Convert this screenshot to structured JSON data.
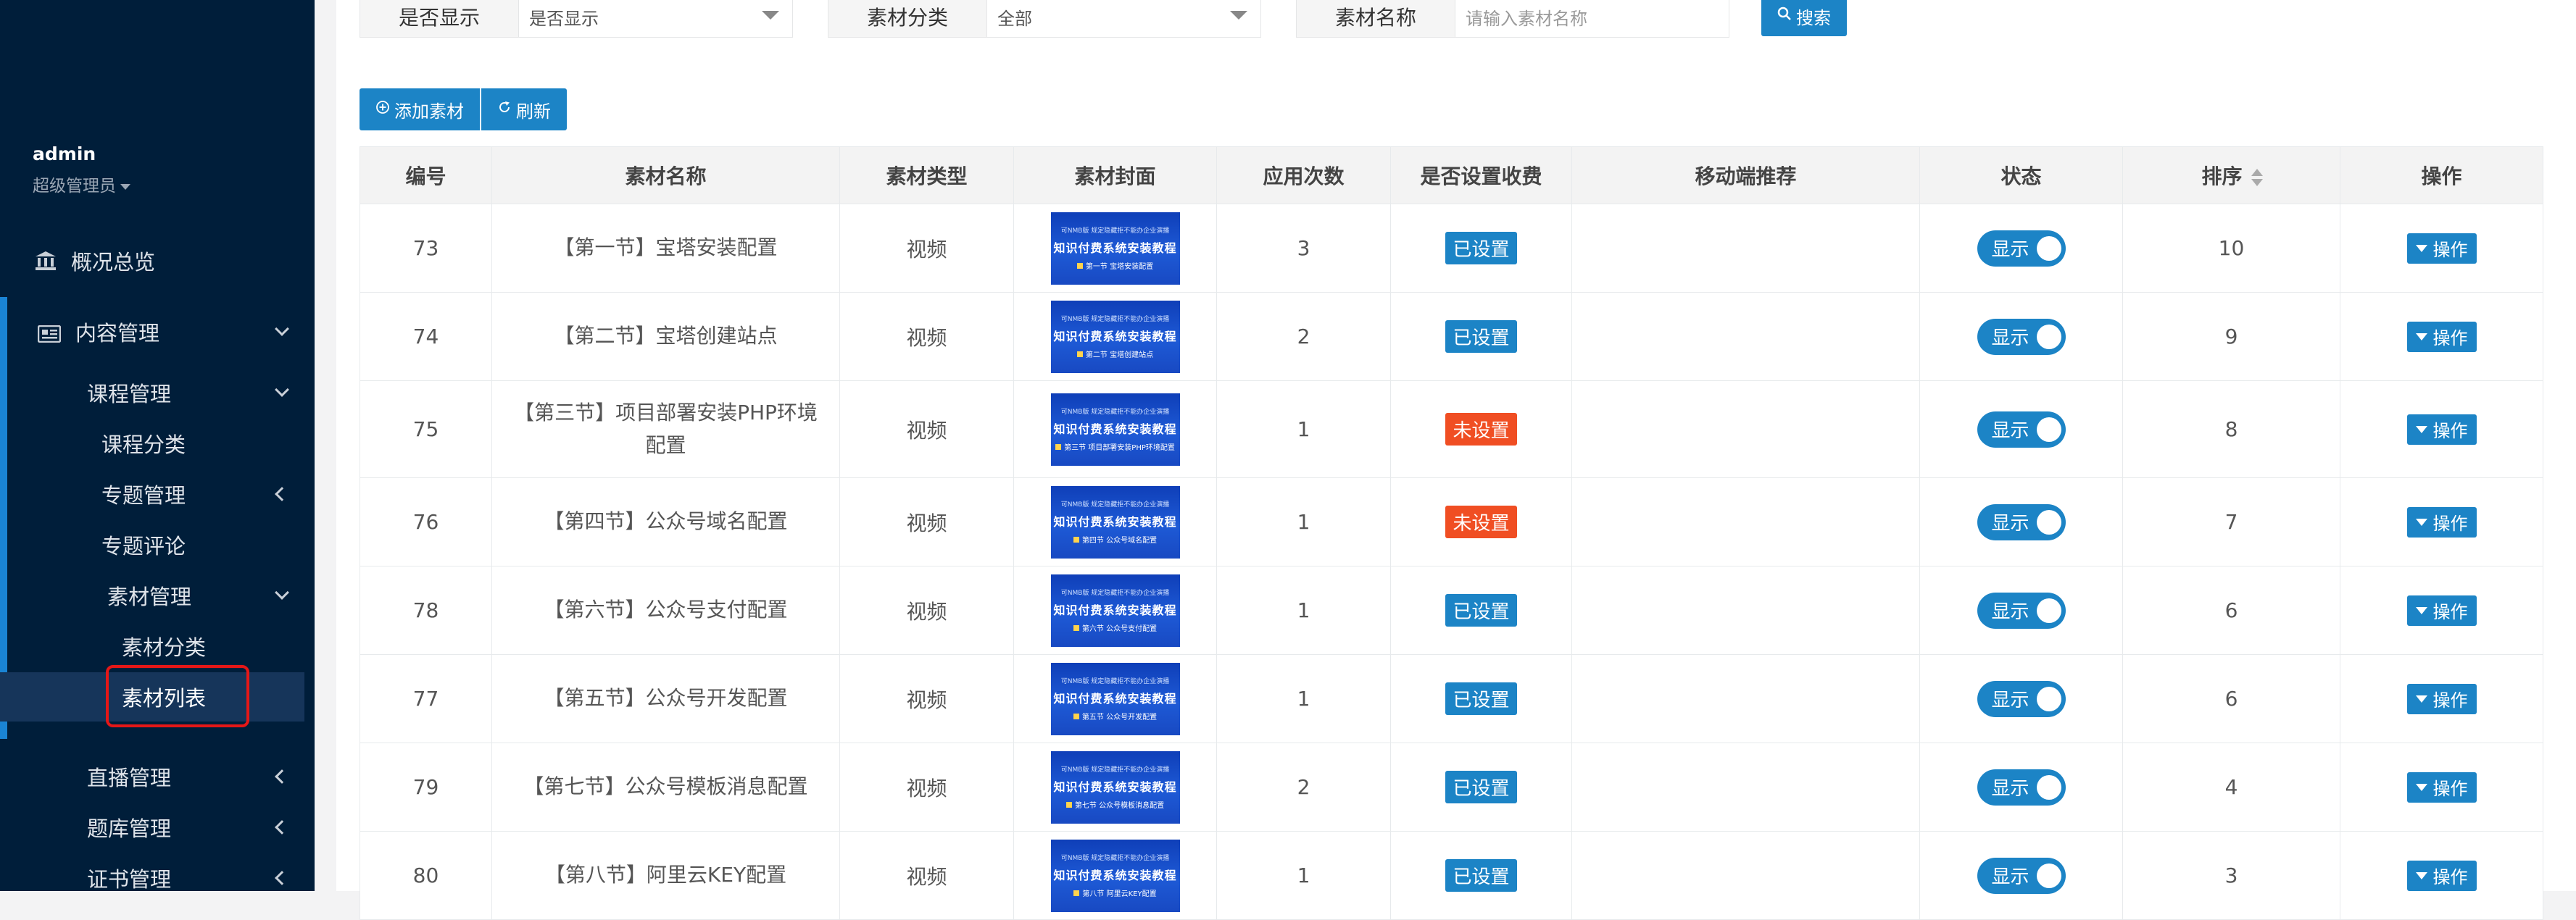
{
  "sidebar": {
    "user": {
      "name": "admin",
      "role": "超级管理员"
    },
    "overview": "概况总览",
    "content_mgmt": "内容管理",
    "course_mgmt": "课程管理",
    "course_category": "课程分类",
    "topic_mgmt": "专题管理",
    "topic_comment": "专题评论",
    "material_mgmt": "素材管理",
    "material_category": "素材分类",
    "material_list": "素材列表",
    "live_mgmt": "直播管理",
    "question_mgmt": "题库管理",
    "cert_mgmt": "证书管理"
  },
  "filters": {
    "show": {
      "label": "是否显示",
      "value": "是否显示"
    },
    "category": {
      "label": "素材分类",
      "value": "全部"
    },
    "name": {
      "label": "素材名称",
      "placeholder": "请输入素材名称"
    },
    "search_btn": "搜索"
  },
  "toolbar": {
    "add": "添加素材",
    "refresh": "刷新"
  },
  "table": {
    "headers": [
      "编号",
      "素材名称",
      "素材类型",
      "素材封面",
      "应用次数",
      "是否设置收费",
      "移动端推荐",
      "状态",
      "排序",
      "操作"
    ],
    "cover": {
      "top": "可NMB版 规定隐藏拒不能办企业演播",
      "title": "知识付费系统安装教程"
    },
    "status_label": "显示",
    "op_label": "操作",
    "rows": [
      {
        "id": "73",
        "name": "【第一节】宝塔安装配置",
        "type": "视频",
        "cover_sub": "第一节 宝塔安装配置",
        "uses": "3",
        "fee": "已设置",
        "fee_color": "#1c84c6",
        "sort": "10"
      },
      {
        "id": "74",
        "name": "【第二节】宝塔创建站点",
        "type": "视频",
        "cover_sub": "第二节 宝塔创建站点",
        "uses": "2",
        "fee": "已设置",
        "fee_color": "#1c84c6",
        "sort": "9"
      },
      {
        "id": "75",
        "name": "【第三节】项目部署安装PHP环境配置",
        "type": "视频",
        "cover_sub": "第三节 项目部署安装PHP环境配置",
        "uses": "1",
        "fee": "未设置",
        "fee_color": "#f04e23",
        "sort": "8"
      },
      {
        "id": "76",
        "name": "【第四节】公众号域名配置",
        "type": "视频",
        "cover_sub": "第四节 公众号域名配置",
        "uses": "1",
        "fee": "未设置",
        "fee_color": "#f04e23",
        "sort": "7"
      },
      {
        "id": "78",
        "name": "【第六节】公众号支付配置",
        "type": "视频",
        "cover_sub": "第六节 公众号支付配置",
        "uses": "1",
        "fee": "已设置",
        "fee_color": "#1c84c6",
        "sort": "6"
      },
      {
        "id": "77",
        "name": "【第五节】公众号开发配置",
        "type": "视频",
        "cover_sub": "第五节 公众号开发配置",
        "uses": "1",
        "fee": "已设置",
        "fee_color": "#1c84c6",
        "sort": "6"
      },
      {
        "id": "79",
        "name": "【第七节】公众号模板消息配置",
        "type": "视频",
        "cover_sub": "第七节 公众号模板消息配置",
        "uses": "2",
        "fee": "已设置",
        "fee_color": "#1c84c6",
        "sort": "4"
      },
      {
        "id": "80",
        "name": "【第八节】阿里云KEY配置",
        "type": "视频",
        "cover_sub": "第八节 阿里云KEY配置",
        "uses": "1",
        "fee": "已设置",
        "fee_color": "#1c84c6",
        "sort": "3"
      }
    ]
  }
}
